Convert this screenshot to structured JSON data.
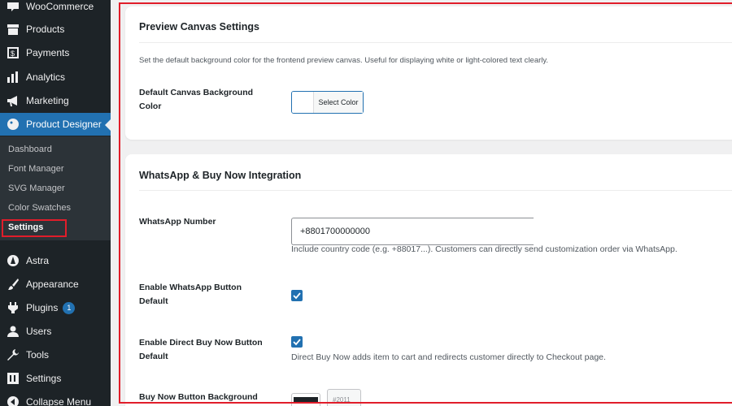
{
  "sidebar": {
    "items": [
      {
        "label": "WooCommerce",
        "icon": "woo-icon"
      },
      {
        "label": "Products",
        "icon": "archive-icon"
      },
      {
        "label": "Payments",
        "icon": "dollar-icon"
      },
      {
        "label": "Analytics",
        "icon": "chart-bar-icon"
      },
      {
        "label": "Marketing",
        "icon": "megaphone-icon"
      },
      {
        "label": "Product Designer",
        "icon": "palette-icon"
      }
    ],
    "submenu": [
      "Dashboard",
      "Font Manager",
      "SVG Manager",
      "Color Swatches",
      "Settings"
    ],
    "items_lower": [
      {
        "label": "Astra",
        "icon": "astra-icon"
      },
      {
        "label": "Appearance",
        "icon": "brush-icon"
      },
      {
        "label": "Plugins",
        "icon": "plug-icon",
        "badge": "1"
      },
      {
        "label": "Users",
        "icon": "user-icon"
      },
      {
        "label": "Tools",
        "icon": "wrench-icon"
      },
      {
        "label": "Settings",
        "icon": "settings-icon"
      },
      {
        "label": "Collapse Menu",
        "icon": "collapse-icon"
      }
    ]
  },
  "preview_canvas": {
    "title": "Preview Canvas Settings",
    "description": "Set the default background color for the frontend preview canvas. Useful for displaying white or light-colored text clearly.",
    "bg_label": "Default Canvas Background Color",
    "select_color": "Select Color",
    "bg_value": "#ffffff"
  },
  "whatsapp": {
    "title": "WhatsApp & Buy Now Integration",
    "number_label": "WhatsApp Number",
    "number_value": "+8801700000000",
    "number_help": "Include country code (e.g. +88017...). Customers can directly send customization order via WhatsApp.",
    "enable_wa_label": "Enable WhatsApp Button Default",
    "enable_wa_checked": true,
    "enable_buy_label": "Enable Direct Buy Now Button Default",
    "enable_buy_checked": true,
    "buy_help": "Direct Buy Now adds item to cart and redirects customer directly to Checkout page.",
    "buy_bg_label": "Buy Now Button Background",
    "buy_bg_value": "#2011"
  },
  "colors": {
    "accent": "#2271b1",
    "highlight": "#e11d2a",
    "sidebar_bg": "#1d2327"
  }
}
